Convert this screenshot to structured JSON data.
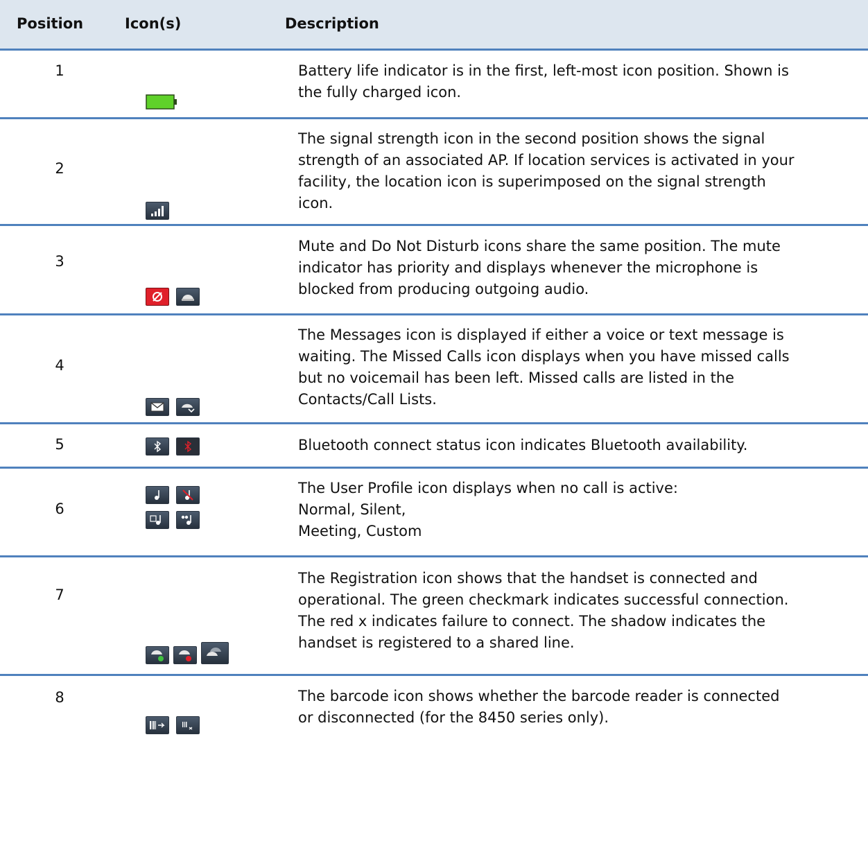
{
  "header": {
    "position": "Position",
    "icons": "Icon(s)",
    "description": "Description"
  },
  "rows": [
    {
      "position": "1",
      "icons": [
        "battery-full-icon"
      ],
      "lines": [
        "Battery life indicator is in the first, left-most icon position. Shown is",
        "the fully charged icon."
      ]
    },
    {
      "position": "2",
      "icons": [
        "signal-strength-icon"
      ],
      "lines": [
        "The signal strength icon in the second position shows the signal",
        "strength of an associated AP. If location services is activated in your",
        "facility, the location icon is superimposed on the signal strength",
        "icon."
      ]
    },
    {
      "position": "3",
      "icons": [
        "mute-icon",
        "do-not-disturb-icon"
      ],
      "lines": [
        "Mute and Do Not Disturb icons share the same position. The mute",
        "indicator has priority and displays whenever the microphone is",
        "blocked from producing outgoing audio."
      ]
    },
    {
      "position": "4",
      "icons": [
        "messages-icon",
        "missed-calls-icon"
      ],
      "lines": [
        "The Messages icon is displayed if either a voice or text message is",
        "waiting. The Missed Calls icon displays when you have missed calls",
        "but no voicemail has been left. Missed calls are listed in the",
        "Contacts/Call Lists."
      ]
    },
    {
      "position": "5",
      "icons": [
        "bluetooth-connected-icon",
        "bluetooth-disconnected-icon"
      ],
      "lines": [
        "Bluetooth connect status icon indicates Bluetooth availability."
      ]
    },
    {
      "position": "6",
      "icons": [
        "profile-normal-icon",
        "profile-silent-icon",
        "profile-meeting-icon",
        "profile-custom-icon"
      ],
      "lines": [
        "The User Profile icon displays when no call is active:",
        "Normal, Silent,",
        "Meeting, Custom"
      ]
    },
    {
      "position": "7",
      "icons": [
        "registration-success-icon",
        "registration-failure-icon",
        "registration-shared-line-icon"
      ],
      "lines": [
        "The Registration icon shows that the handset is connected and",
        "operational. The green checkmark indicates successful connection.",
        "The red x indicates failure to connect. The shadow indicates the",
        "handset is registered to a shared line."
      ]
    },
    {
      "position": "8",
      "icons": [
        "barcode-connected-icon",
        "barcode-disconnected-icon"
      ],
      "lines": [
        "The barcode icon shows whether the barcode reader is connected",
        "or disconnected (for the 8450 series only)."
      ]
    }
  ],
  "colors": {
    "header_bg": "#dde6ef",
    "rule": "#4f81bd",
    "battery": "#5fd12a",
    "alert_red": "#e0202a"
  }
}
